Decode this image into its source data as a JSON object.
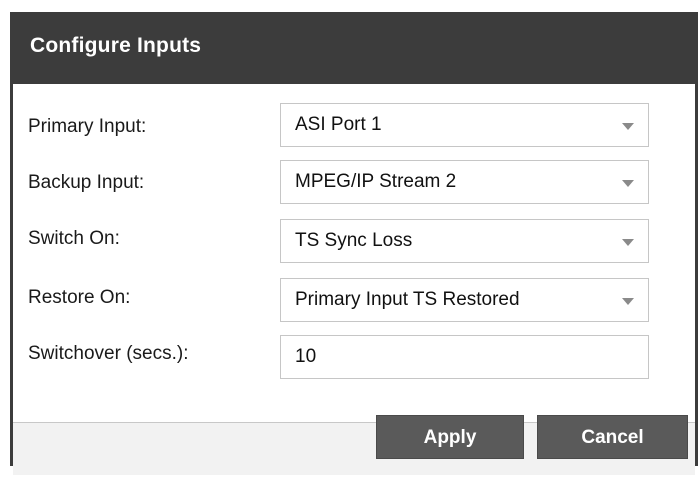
{
  "dialog": {
    "title": "Configure Inputs",
    "fields": {
      "primary_input": {
        "label": "Primary Input:",
        "value": "ASI Port 1"
      },
      "backup_input": {
        "label": "Backup Input:",
        "value": "MPEG/IP Stream 2"
      },
      "switch_on": {
        "label": "Switch On:",
        "value": "TS Sync Loss"
      },
      "restore_on": {
        "label": "Restore On:",
        "value": "Primary Input TS Restored"
      },
      "switchover": {
        "label": "Switchover (secs.):",
        "value": "10"
      }
    },
    "buttons": {
      "apply": "Apply",
      "cancel": "Cancel"
    }
  },
  "icons": {
    "dropdown": "chevron-down-icon"
  },
  "colors": {
    "titlebar": "#3c3c3c",
    "button": "#5a5a5a",
    "footer": "#f2f2f2"
  }
}
